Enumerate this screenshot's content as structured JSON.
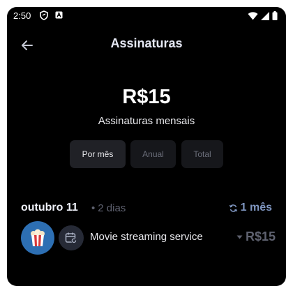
{
  "status_bar": {
    "time": "2:50",
    "icons": [
      "shield-icon",
      "a-badge-icon",
      "wifi-icon",
      "signal-icon",
      "battery-icon"
    ]
  },
  "header": {
    "title": "Assinaturas",
    "back_icon": "arrow-left-icon"
  },
  "summary": {
    "amount": "R$15",
    "caption": "Assinaturas mensais"
  },
  "tabs": [
    {
      "label": "Por mês",
      "selected": true
    },
    {
      "label": "Anual",
      "selected": false
    },
    {
      "label": "Total",
      "selected": false
    }
  ],
  "groups": [
    {
      "date": "outubro 11",
      "separator": "•",
      "days_until": "2 dias",
      "cycle_icon": "refresh-icon",
      "cycle_label": "1 mês",
      "subscriptions": [
        {
          "name": "Movie streaming service",
          "price": "R$15",
          "logo_icon": "popcorn-icon",
          "badge_icon": "calendar-refresh-icon",
          "trend_icon": "caret-down-icon"
        }
      ]
    }
  ],
  "colors": {
    "background": "#000000",
    "title": "#e6e9f5",
    "accent_cycle": "#7e95bf",
    "muted": "#5f6270",
    "logo_bg": "#2d6fb3",
    "tab_active_bg": "#202126",
    "tab_inactive_bg": "#16171b"
  }
}
